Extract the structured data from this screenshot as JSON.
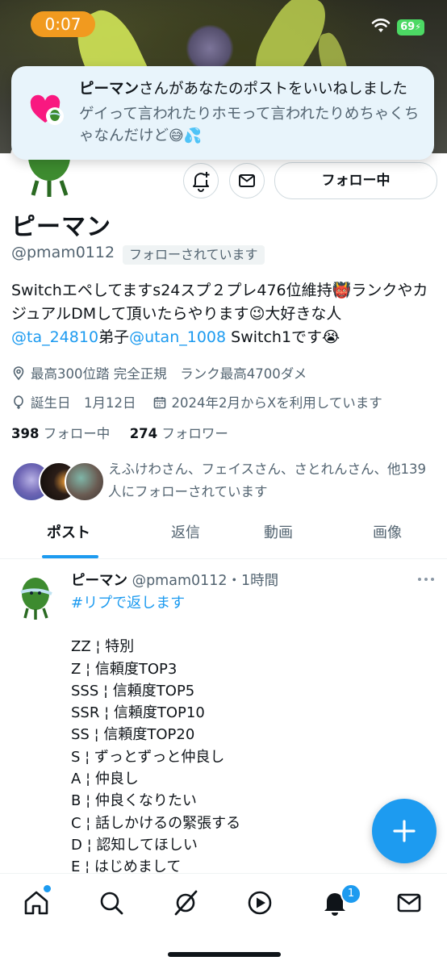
{
  "status_bar": {
    "time": "0:07",
    "battery": "69"
  },
  "notification": {
    "title_name": "ピーマン",
    "title_rest": "さんがあなたのポストをいいねしました",
    "body": "ゲイって言われたりホモって言われたりめちゃくちゃなんだけど",
    "body_emoji": "😅💦"
  },
  "profile": {
    "follow_button": "フォロー中",
    "display_name": "ピーマン",
    "handle": "@pmam0112",
    "follows_you": "フォローされています",
    "bio": {
      "part1": "Switchエペしてますs24スプ２プレ476位維持",
      "emoji1": "👹",
      "part2": "ランクやカジュアルDMして頂いたらやります",
      "emoji2": "😉",
      "part3": "大好きな人",
      "mention1": "@ta_24810",
      "part4": "弟子",
      "mention2": "@utan_1008",
      "part5": " Switch1です",
      "emoji3": "😭"
    },
    "location": "最高300位踏 完全正規　ランク最高4700ダメ",
    "birthday": "誕生日　1月12日",
    "joined": "2024年2月からXを利用しています",
    "following_count": "398",
    "following_label": "フォロー中",
    "followers_count": "274",
    "followers_label": "フォロワー",
    "followers_you_know": "えふけわさん、フェイスさん、さとれんさん、他139人にフォローされています"
  },
  "tabs": [
    {
      "label": "ポスト"
    },
    {
      "label": "返信"
    },
    {
      "label": "動画"
    },
    {
      "label": "画像"
    }
  ],
  "post": {
    "name": "ピーマン",
    "handle_time": "@pmam0112・1時間",
    "hashtag": "#リプで返します",
    "lines": [
      "ZZ ¦ 特別",
      "Z ¦ 信頼度TOP3",
      "SSS ¦ 信頼度TOP5",
      "SSR ¦ 信頼度TOP10",
      "SS ¦ 信頼度TOP20",
      "S ¦ ずっとずっと仲良し",
      "A ¦ 仲良し",
      "B ¦ 仲良くなりたい",
      "C ¦ 話しかけるの緊張する",
      "D ¦ 認知してほしい",
      "E ¦ はじめまして"
    ]
  },
  "bottom_nav": {
    "notifications_badge": "1"
  },
  "colors": {
    "accent": "#1d9bf0",
    "text": "#0f1419",
    "secondary": "#536471",
    "status_pill": "#f19a1f"
  }
}
